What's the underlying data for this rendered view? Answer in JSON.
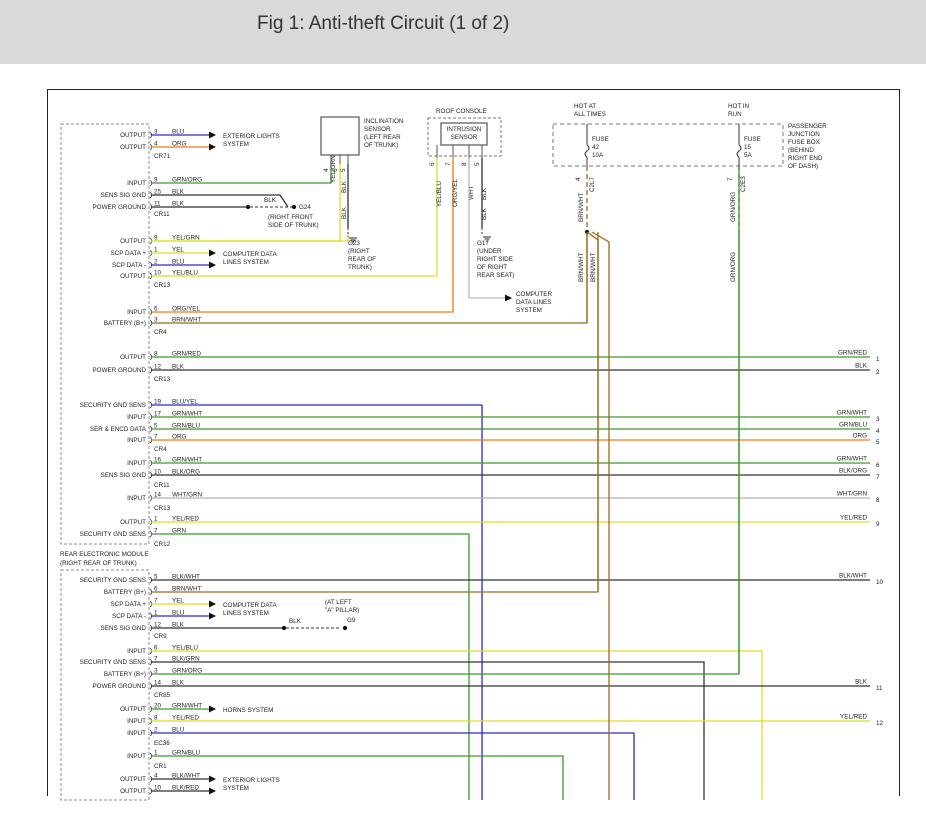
{
  "title": "Fig 1: Anti-theft Circuit (1 of 2)",
  "colors": {
    "BLU": "#2a2ad0",
    "ORG": "#ee7a10",
    "GRN": "#3a9a2a",
    "YEL": "#dede20",
    "BRN": "#9a6a20",
    "BLK": "#333333",
    "WHT": "#b0b0b0",
    "RED": "#cc2020"
  },
  "module_labels": [
    {
      "id": "out1",
      "text": "OUTPUT"
    },
    {
      "id": "out2",
      "text": "OUTPUT"
    },
    {
      "id": "in1",
      "text": "INPUT"
    },
    {
      "id": "ssg1",
      "text": "SENS SIG GND"
    },
    {
      "id": "pg1",
      "text": "POWER GROUND"
    },
    {
      "id": "out3",
      "text": "OUTPUT"
    },
    {
      "id": "scp1",
      "text": "SCP DATA +"
    },
    {
      "id": "scp2",
      "text": "SCP DATA -"
    },
    {
      "id": "out4",
      "text": "OUTPUT"
    },
    {
      "id": "in2",
      "text": "INPUT"
    },
    {
      "id": "bat1",
      "text": "BATTERY (B+)"
    },
    {
      "id": "out5",
      "text": "OUTPUT"
    },
    {
      "id": "pg2",
      "text": "POWER GROUND"
    },
    {
      "id": "sgs1",
      "text": "SECURITY GND SENS"
    },
    {
      "id": "in3",
      "text": "INPUT"
    },
    {
      "id": "ser",
      "text": "SER & ENCD DATA"
    },
    {
      "id": "in4",
      "text": "INPUT"
    },
    {
      "id": "in5",
      "text": "INPUT"
    },
    {
      "id": "ssg2",
      "text": "SENS SIG GND"
    },
    {
      "id": "in6",
      "text": "INPUT"
    },
    {
      "id": "out6",
      "text": "OUTPUT"
    },
    {
      "id": "sgs2",
      "text": "SECURITY GND SENS"
    },
    {
      "id": "sgs3",
      "text": "SECURITY GND SENS"
    },
    {
      "id": "bat2",
      "text": "BATTERY (B+)"
    },
    {
      "id": "scp3",
      "text": "SCP DATA +"
    },
    {
      "id": "scp4",
      "text": "SCP DATA -"
    },
    {
      "id": "ssg3",
      "text": "SENS SIG GND"
    },
    {
      "id": "in7",
      "text": "INPUT"
    },
    {
      "id": "sgs4",
      "text": "SECURITY GND SENS"
    },
    {
      "id": "bat3",
      "text": "BATTERY (B+)"
    },
    {
      "id": "pg3",
      "text": "POWER GROUND"
    },
    {
      "id": "out7",
      "text": "OUTPUT"
    },
    {
      "id": "in8",
      "text": "INPUT"
    },
    {
      "id": "in9",
      "text": "INPUT"
    },
    {
      "id": "in10",
      "text": "INPUT"
    },
    {
      "id": "out8",
      "text": "OUTPUT"
    },
    {
      "id": "out9",
      "text": "OUTPUT"
    }
  ],
  "module2_title": "REAR ELECTRONIC MODULE",
  "module2_subtitle": "(RIGHT REAR OF TRUNK)",
  "connectors": [
    "CR71",
    "CR11",
    "CR13",
    "CR4",
    "CR13",
    "CR4",
    "CR11",
    "CR13",
    "CR12",
    "CR9",
    "CR85",
    "EC36",
    "CR1"
  ],
  "wires": [
    {
      "pin": "3",
      "label": "BLU",
      "color": "BLU"
    },
    {
      "pin": "4",
      "label": "ORG",
      "color": "ORG"
    },
    {
      "pin": "9",
      "label": "GRN/ORG",
      "color": "GRN",
      "stripe": "ORG"
    },
    {
      "pin": "25",
      "label": "BLK",
      "color": "BLK"
    },
    {
      "pin": "11",
      "label": "BLK",
      "color": "BLK"
    },
    {
      "pin": "9",
      "label": "YEL/GRN",
      "color": "YEL",
      "stripe": "GRN"
    },
    {
      "pin": "1",
      "label": "YEL",
      "color": "YEL"
    },
    {
      "pin": "2",
      "label": "BLU",
      "color": "BLU"
    },
    {
      "pin": "10",
      "label": "YEL/BLU",
      "color": "YEL",
      "stripe": "BLU"
    },
    {
      "pin": "6",
      "label": "ORG/YEL",
      "color": "ORG",
      "stripe": "YEL"
    },
    {
      "pin": "3",
      "label": "BRN/WHT",
      "color": "BRN",
      "stripe": "WHT"
    },
    {
      "pin": "8",
      "label": "GRN/RED",
      "color": "GRN",
      "stripe": "RED",
      "right_label": "GRN/RED",
      "ref": "1"
    },
    {
      "pin": "12",
      "label": "BLK",
      "color": "BLK",
      "right_label": "BLK",
      "ref": "2"
    },
    {
      "pin": "19",
      "label": "BLU/YEL",
      "color": "BLU",
      "stripe": "YEL"
    },
    {
      "pin": "17",
      "label": "GRN/WHT",
      "color": "GRN",
      "stripe": "WHT",
      "right_label": "GRN/WHT",
      "ref": "3"
    },
    {
      "pin": "5",
      "label": "GRN/BLU",
      "color": "GRN",
      "stripe": "BLU",
      "right_label": "GRN/BLU",
      "ref": "4"
    },
    {
      "pin": "7",
      "label": "ORG",
      "color": "ORG",
      "right_label": "ORG",
      "ref": "5"
    },
    {
      "pin": "16",
      "label": "GRN/WHT",
      "color": "GRN",
      "stripe": "WHT",
      "right_label": "GRN/WHT",
      "ref": "6"
    },
    {
      "pin": "10",
      "label": "BLK/ORG",
      "color": "BLK",
      "stripe": "ORG",
      "right_label": "BLK/ORG",
      "ref": "7"
    },
    {
      "pin": "14",
      "label": "WHT/GRN",
      "color": "WHT",
      "stripe": "GRN",
      "right_label": "WHT/GRN",
      "ref": "8"
    },
    {
      "pin": "1",
      "label": "YEL/RED",
      "color": "YEL",
      "stripe": "RED",
      "right_label": "YEL/RED",
      "ref": "9"
    },
    {
      "pin": "7",
      "label": "GRN",
      "color": "GRN"
    },
    {
      "pin": "5",
      "label": "BLK/WHT",
      "color": "BLK",
      "stripe": "WHT",
      "right_label": "BLK/WHT",
      "ref": "10"
    },
    {
      "pin": "6",
      "label": "BRN/WHT",
      "color": "BRN",
      "stripe": "WHT"
    },
    {
      "pin": "7",
      "label": "YEL",
      "color": "YEL"
    },
    {
      "pin": "1",
      "label": "BLU",
      "color": "BLU"
    },
    {
      "pin": "12",
      "label": "BLK",
      "color": "BLK"
    },
    {
      "pin": "6",
      "label": "YEL/BLU",
      "color": "YEL",
      "stripe": "BLU"
    },
    {
      "pin": "7",
      "label": "BLK/GRN",
      "color": "BLK",
      "stripe": "GRN"
    },
    {
      "pin": "3",
      "label": "GRN/ORG",
      "color": "GRN",
      "stripe": "ORG"
    },
    {
      "pin": "14",
      "label": "BLK",
      "color": "BLK",
      "right_label": "BLK",
      "ref": "11"
    },
    {
      "pin": "20",
      "label": "GRN/WHT",
      "color": "GRN",
      "stripe": "WHT"
    },
    {
      "pin": "8",
      "label": "YEL/RED",
      "color": "YEL",
      "stripe": "RED",
      "right_label": "YEL/RED",
      "ref": "12"
    },
    {
      "pin": "2",
      "label": "BLU",
      "color": "BLU"
    },
    {
      "pin": "1",
      "label": "GRN/BLU",
      "color": "GRN",
      "stripe": "BLU"
    },
    {
      "pin": "4",
      "label": "BLK/WHT",
      "color": "BLK",
      "stripe": "WHT"
    },
    {
      "pin": "10",
      "label": "BLK/RED",
      "color": "BLK",
      "stripe": "RED"
    }
  ],
  "targets": {
    "ext_lights_1": [
      "EXTERIOR LIGHTS",
      "SYSTEM"
    ],
    "data_lines_1": [
      "COMPUTER DATA",
      "LINES SYSTEM"
    ],
    "data_lines_2": [
      "COMPUTER",
      "DATA LINES",
      "SYSTEM"
    ],
    "data_lines_3": [
      "COMPUTER DATA",
      "LINES SYSTEM"
    ],
    "horns": [
      "HORNS SYSTEM"
    ],
    "ext_lights_2": [
      "EXTERIOR LIGHTS",
      "SYSTEM"
    ]
  },
  "grounds": {
    "g24": {
      "wire": "BLK",
      "name": "G24",
      "desc": [
        "(RIGHT FRONT",
        "SIDE OF TRUNK)"
      ]
    },
    "g23": {
      "name": "G23",
      "desc": [
        "(RIGHT",
        "REAR OF",
        "TRUNK)"
      ]
    },
    "g17": {
      "name": "G17",
      "desc": [
        "(UNDER",
        "RIGHT SIDE",
        "OF RIGHT",
        "REAR SEAT)"
      ]
    },
    "g9": {
      "wire": "BLK",
      "name": "G9",
      "desc": [
        "(AT LEFT",
        "\"A\" PILLAR)"
      ]
    }
  },
  "inclination_sensor": {
    "label": [
      "INCLINATION",
      "SENSOR",
      "(LEFT REAR",
      "OF TRUNK)"
    ],
    "pins": [
      "4",
      "6",
      "5"
    ],
    "wires": [
      "GRN/ORG",
      "YEL/GRN",
      "BLK",
      "BLK"
    ]
  },
  "roof_console": {
    "title": "ROOF CONSOLE",
    "sensor": [
      "INTRUSION",
      "SENSOR"
    ],
    "pins": [
      "6",
      "7",
      "8",
      "5"
    ],
    "wires": [
      "YEL/BLU",
      "ORG/YEL",
      "WHT",
      "BLK",
      "BLK"
    ]
  },
  "fuse_box": {
    "hot_at": [
      "HOT AT",
      "ALL TIMES"
    ],
    "hot_in": [
      "HOT IN",
      "RUN"
    ],
    "fuse1": [
      "FUSE",
      "42",
      "10A"
    ],
    "fuse2": [
      "FUSE",
      "15",
      "5A"
    ],
    "desc": [
      "PASSENGER",
      "JUNCTION",
      "FUSE BOX",
      "(BEHIND",
      "RIGHT END",
      "OF DASH)"
    ],
    "pin1": "4",
    "pin2": "7",
    "conn1": "C2L7",
    "conn2": "C2E3",
    "wires": [
      "BRN/WHT",
      "BRN/WHT",
      "BRN/WHT",
      "GRN/ORG",
      "GRN/ORG"
    ]
  }
}
